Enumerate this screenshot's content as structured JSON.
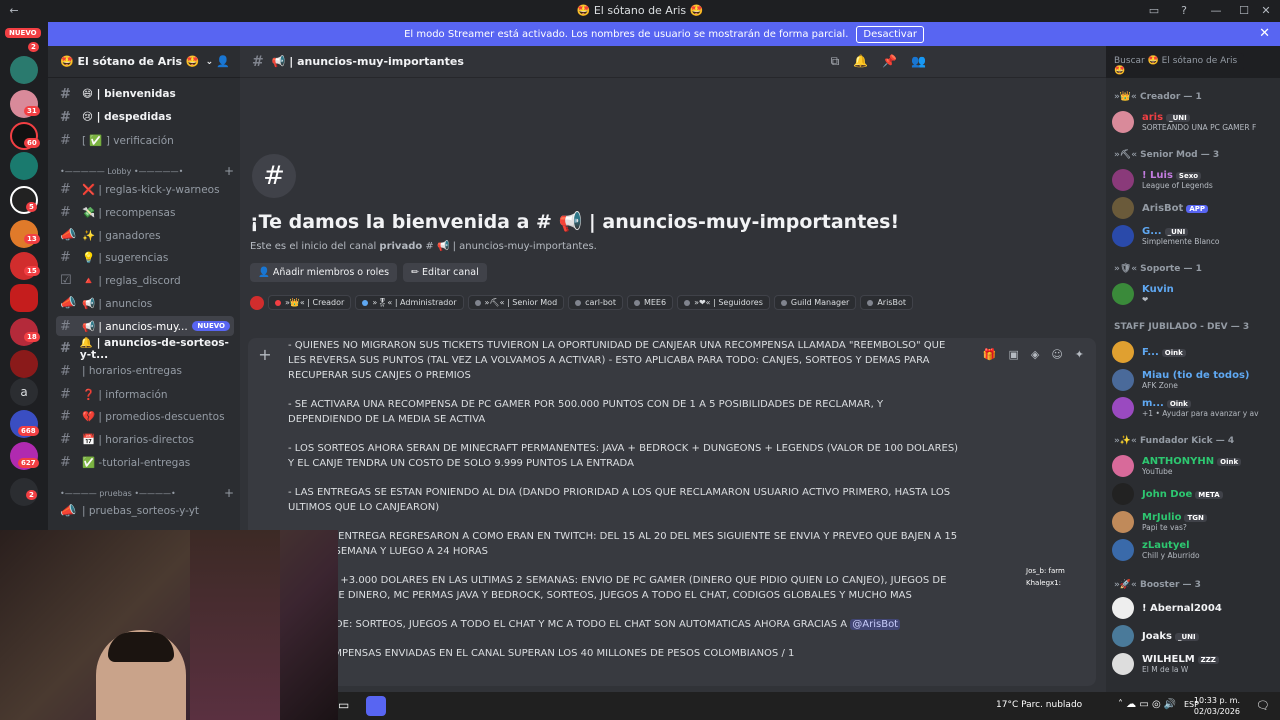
{
  "window": {
    "title": "🤩 El sótano de Aris 🤩"
  },
  "banner": {
    "text": "El modo Streamer está activado. Los nombres de usuario se mostrarán de forma parcial.",
    "button": "Desactivar"
  },
  "servers": {
    "nuevo": "NUEVO",
    "badges": [
      "2",
      "31",
      "60",
      "5",
      "13",
      "15",
      "18",
      "668",
      "627",
      "2"
    ],
    "letter": "a"
  },
  "guild": {
    "name": "🤩 El sótano de Aris 🤩"
  },
  "channels": {
    "items": [
      {
        "label": "😄 | bienvenidas"
      },
      {
        "label": "😢 | despedidas"
      },
      {
        "label": "[ ✅ ] verificación"
      },
      {
        "label": "❌ | reglas-kick-y-warneos"
      },
      {
        "label": "💸 | recompensas"
      },
      {
        "label": "✨ | ganadores"
      },
      {
        "label": "💡 | sugerencias"
      },
      {
        "label": "🔺 | reglas_discord"
      },
      {
        "label": "📢 | anuncios"
      },
      {
        "label": "📢 | anuncios-muy..."
      },
      {
        "label": "🔔 | anuncios-de-sorteos-y-t..."
      },
      {
        "label": "| horarios-entregas"
      },
      {
        "label": "❓ | información"
      },
      {
        "label": "💔 | promedios-descuentos"
      },
      {
        "label": "📅 | horarios-directos"
      },
      {
        "label": "✅ -tutorial-entregas"
      },
      {
        "label": "| pruebas_sorteos-y-yt"
      }
    ],
    "cat_lobby": "•————— Lobby •—————•",
    "cat_pruebas": "•———— pruebas •————•",
    "new_tag": "NUEVO"
  },
  "header": {
    "channel": "📢 | anuncios-muy-importantes",
    "search": "Buscar 🤩 El sótano de Aris 🤩"
  },
  "welcome": {
    "title": "¡Te damos la bienvenida a # 📢 | anuncios-muy-importantes!",
    "sub_prefix": "Este es el inicio del canal ",
    "sub_bold": "privado",
    "sub_suffix": " # 📢 | anuncios-muy-importantes.",
    "add_btn": "👤 Añadir miembros o roles",
    "edit_btn": "✏ Editar canal"
  },
  "roles": [
    "»👑« | Creador",
    "»🎖« | Administrador",
    "»⛏« | Senior Mod",
    "carl-bot",
    "MEE6",
    "»❤« | Seguidores",
    "Guild Manager",
    "ArisBot"
  ],
  "editor": {
    "paragraphs": [
      "- QUIENES NO MIGRARON SUS TICKETS TUVIERON LA OPORTUNIDAD DE CANJEAR UNA RECOMPENSA LLAMADA \"REEMBOLSO\" QUE LES REVERSA SUS PUNTOS (TAL VEZ LA VOLVAMOS A ACTIVAR) - ESTO APLICABA PARA TODO: CANJES, SORTEOS Y DEMAS PARA RECUPERAR SUS CANJES O PREMIOS",
      "- SE ACTIVARA UNA RECOMPENSA DE PC GAMER POR 500.000 PUNTOS CON DE 1 A 5 POSIBILIDADES DE RECLAMAR, Y DEPENDIENDO DE LA MEDIA SE ACTIVA",
      "- LOS SORTEOS AHORA SERAN DE MINECRAFT PERMANENTES: JAVA + BEDROCK + DUNGEONS + LEGENDS (VALOR DE 100 DOLARES) Y EL CANJE TENDRA UN COSTO DE SOLO 9.999 PUNTOS LA ENTRADA",
      "- LAS ENTREGAS SE ESTAN PONIENDO AL DIA (DANDO PRIORIDAD A LOS QUE RECLAMARON USUARIO ACTIVO PRIMERO, HASTA LOS ULTIMOS QUE LO CANJEARON)",
      "...POS DE ENTREGA REGRESARON A COMO ERAN EN TWITCH: DEL 15 AL 20 DEL MES SIGUIENTE SE ENVIA Y PREVEO QUE BAJEN A 15 ...SO A 1 SEMANA Y LUEGO A 24 HORAS",
      "...NVIADO +3.000 DOLARES EN LAS ULTIMAS 2 SEMANAS: ENVIO DE PC GAMER (DINERO QUE PIDIO QUIEN LO CANJEO), JUEGOS DE ...ANJES DE DINERO, MC PERMAS JAVA Y BEDROCK, SORTEOS, JUEGOS A TODO EL CHAT, CODIGOS GLOBALES Y MUCHO MAS"
    ],
    "auto_line": "...REGAS DE: SORTEOS, JUEGOS A TODO EL CHAT Y MC A TODO EL CHAT SON AUTOMATICAS AHORA GRACIAS A ",
    "mention": "@ArisBot",
    "last_line": "DE RECOMPENSAS ENVIADAS EN EL CANAL SUPERAN LOS 40 MILLONES DE PESOS COLOMBIANOS / 1"
  },
  "members": {
    "cat_creador": "»👑« Creador — 1",
    "cat_senior": "»⛏« Senior Mod — 3",
    "cat_soporte": "»🛡« Soporte — 1",
    "cat_staff": "STAFF JUBILADO - DEV — 3",
    "cat_fundador": "»✨« Fundador Kick — 4",
    "cat_booster": "»🚀« Booster — 3",
    "list": [
      {
        "name": "aris",
        "tag": "_UNI",
        "sub": "SORTEANDO UNA PC GAMER F",
        "color": "#f23f43"
      },
      {
        "name": "! Luis",
        "tag": "Sexo",
        "sub": "League of Legends",
        "color": "#c27cdf"
      },
      {
        "name": "ArisBot",
        "tag": "APP",
        "sub": "",
        "color": "#949ba4"
      },
      {
        "name": "G...",
        "tag": "_UNI",
        "sub": "Simplemente Blanco",
        "color": "#5fa8f2"
      },
      {
        "name": "Kuvin",
        "tag": "",
        "sub": "❤",
        "color": "#5fa8f2"
      },
      {
        "name": "F...",
        "tag": "Oink",
        "sub": "",
        "color": "#5fa8f2"
      },
      {
        "name": "Miau (tio de todos)",
        "tag": "",
        "sub": "AFK Zone",
        "color": "#5fa8f2"
      },
      {
        "name": "m...",
        "tag": "Oink",
        "sub": "+1 • Ayudar para avanzar y av",
        "color": "#5fa8f2"
      },
      {
        "name": "ANTHONYHN",
        "tag": "Oink",
        "sub": "YouTube",
        "color": "#2dc770"
      },
      {
        "name": "John Doe",
        "tag": "META",
        "sub": "",
        "color": "#2dc770"
      },
      {
        "name": "MrJulio",
        "tag": "TGN",
        "sub": "Papi te vas?",
        "color": "#2dc770"
      },
      {
        "name": "zLautyel",
        "tag": "",
        "sub": "Chill y Aburrido",
        "color": "#2dc770"
      },
      {
        "name": "! Abernal2004",
        "tag": "",
        "sub": "",
        "color": "#f2f3f5"
      },
      {
        "name": "Joaks",
        "tag": "_UNI",
        "sub": "",
        "color": "#f2f3f5"
      },
      {
        "name": "WILHELM",
        "tag": "ZZZ",
        "sub": "El M de la W",
        "color": "#f2f3f5"
      }
    ]
  },
  "chat_overlay": {
    "line1": "Jos_b: farm",
    "line2": "Khalegx1:"
  },
  "taskbar": {
    "weather": "17°C  Parc. nublado",
    "lang": "ESP",
    "time": "10:33 p. m.",
    "date": "02/03/2026"
  }
}
